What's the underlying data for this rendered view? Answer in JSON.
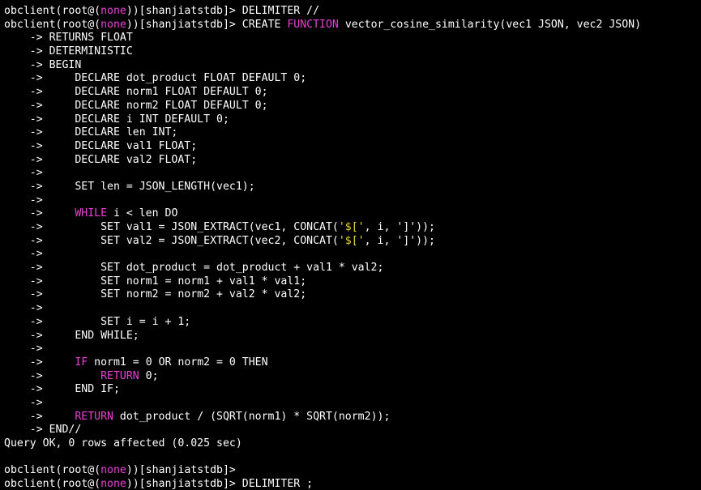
{
  "colors": {
    "background": "#000000",
    "text": "#ffffff",
    "keyword": "#ea3fd6",
    "string": "#e9d43a"
  },
  "terminal": {
    "lines": [
      [
        {
          "t": "obclient(root@("
        },
        {
          "t": "none",
          "c": "kw"
        },
        {
          "t": "))[shanjiatstdb]> DELIMITER //"
        }
      ],
      [
        {
          "t": "obclient(root@("
        },
        {
          "t": "none",
          "c": "kw"
        },
        {
          "t": "))[shanjiatstdb]> CREATE "
        },
        {
          "t": "FUNCTION",
          "c": "kw"
        },
        {
          "t": " vector_cosine_similarity(vec1 JSON, vec2 JSON)"
        }
      ],
      [
        {
          "t": "    -> RETURNS FLOAT"
        }
      ],
      [
        {
          "t": "    -> DETERMINISTIC"
        }
      ],
      [
        {
          "t": "    -> BEGIN"
        }
      ],
      [
        {
          "t": "    ->     DECLARE dot_product FLOAT DEFAULT 0;"
        }
      ],
      [
        {
          "t": "    ->     DECLARE norm1 FLOAT DEFAULT 0;"
        }
      ],
      [
        {
          "t": "    ->     DECLARE norm2 FLOAT DEFAULT 0;"
        }
      ],
      [
        {
          "t": "    ->     DECLARE i INT DEFAULT 0;"
        }
      ],
      [
        {
          "t": "    ->     DECLARE len INT;"
        }
      ],
      [
        {
          "t": "    ->     DECLARE val1 FLOAT;"
        }
      ],
      [
        {
          "t": "    ->     DECLARE val2 FLOAT;"
        }
      ],
      [
        {
          "t": "    ->"
        }
      ],
      [
        {
          "t": "    ->     SET len = JSON_LENGTH(vec1);"
        }
      ],
      [
        {
          "t": "    ->"
        }
      ],
      [
        {
          "t": "    ->     "
        },
        {
          "t": "WHILE",
          "c": "kw"
        },
        {
          "t": " i < len DO"
        }
      ],
      [
        {
          "t": "    ->         SET val1 = JSON_EXTRACT(vec1, CONCAT("
        },
        {
          "t": "'$['",
          "c": "str"
        },
        {
          "t": ", i, ']'));"
        }
      ],
      [
        {
          "t": "    ->         SET val2 = JSON_EXTRACT(vec2, CONCAT("
        },
        {
          "t": "'$['",
          "c": "str"
        },
        {
          "t": ", i, ']'));"
        }
      ],
      [
        {
          "t": "    ->"
        }
      ],
      [
        {
          "t": "    ->         SET dot_product = dot_product + val1 * val2;"
        }
      ],
      [
        {
          "t": "    ->         SET norm1 = norm1 + val1 * val1;"
        }
      ],
      [
        {
          "t": "    ->         SET norm2 = norm2 + val2 * val2;"
        }
      ],
      [
        {
          "t": "    ->"
        }
      ],
      [
        {
          "t": "    ->         SET i = i + 1;"
        }
      ],
      [
        {
          "t": "    ->     END WHILE;"
        }
      ],
      [
        {
          "t": "    ->"
        }
      ],
      [
        {
          "t": "    ->     "
        },
        {
          "t": "IF",
          "c": "kw"
        },
        {
          "t": " norm1 = 0 OR norm2 = 0 THEN"
        }
      ],
      [
        {
          "t": "    ->         "
        },
        {
          "t": "RETURN",
          "c": "kw"
        },
        {
          "t": " 0;"
        }
      ],
      [
        {
          "t": "    ->     END IF;"
        }
      ],
      [
        {
          "t": "    ->"
        }
      ],
      [
        {
          "t": "    ->     "
        },
        {
          "t": "RETURN",
          "c": "kw"
        },
        {
          "t": " dot_product / (SQRT(norm1) * SQRT(norm2));"
        }
      ],
      [
        {
          "t": "    -> END//"
        }
      ],
      [
        {
          "t": "Query OK, 0 rows affected (0.025 sec)"
        }
      ],
      [
        {
          "t": ""
        }
      ],
      [
        {
          "t": "obclient(root@("
        },
        {
          "t": "none",
          "c": "kw"
        },
        {
          "t": "))[shanjiatstdb]>"
        }
      ],
      [
        {
          "t": "obclient(root@("
        },
        {
          "t": "none",
          "c": "kw"
        },
        {
          "t": "))[shanjiatstdb]> DELIMITER ;"
        }
      ]
    ]
  }
}
